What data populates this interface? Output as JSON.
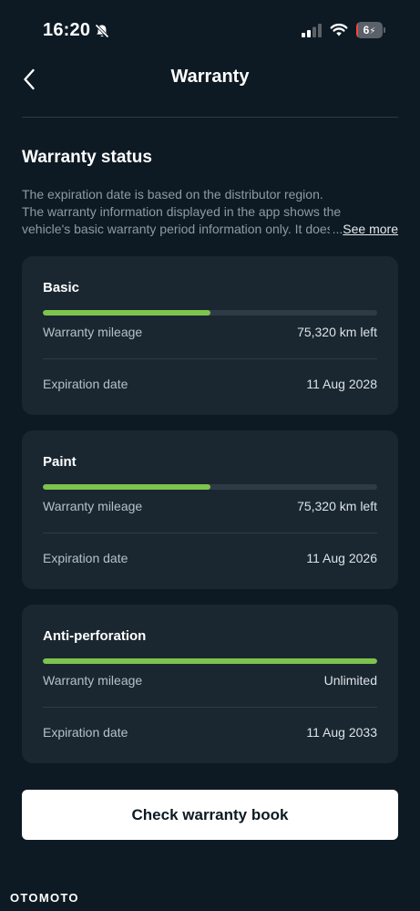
{
  "status_bar": {
    "time": "16:20",
    "battery_level": "6",
    "battery_fraction": 0.06,
    "battery_color": "#ff453a",
    "icons": [
      "bell-off-icon",
      "signal-icon",
      "wifi-icon",
      "battery-icon"
    ]
  },
  "header": {
    "title": "Warranty",
    "back_icon": "chevron-left-icon"
  },
  "section": {
    "title": "Warranty status",
    "description_lines": [
      "The expiration date is based on the distributor region.",
      "The warranty information displayed in the app shows the",
      "vehicle's basic warranty period information only. It does"
    ],
    "see_more": "See more",
    "ellipsis": "..."
  },
  "cards": [
    {
      "title": "Basic",
      "progress": 0.5,
      "mileage_label": "Warranty mileage",
      "mileage_value": "75,320 km left",
      "expiry_label": "Expiration date",
      "expiry_value": "11 Aug 2028"
    },
    {
      "title": "Paint",
      "progress": 0.5,
      "mileage_label": "Warranty mileage",
      "mileage_value": "75,320 km left",
      "expiry_label": "Expiration date",
      "expiry_value": "11 Aug 2026"
    },
    {
      "title": "Anti-perforation",
      "progress": 1.0,
      "mileage_label": "Warranty mileage",
      "mileage_value": "Unlimited",
      "expiry_label": "Expiration date",
      "expiry_value": "11 Aug 2033"
    }
  ],
  "actions": {
    "check_button": "Check warranty book"
  },
  "watermark": "OTOMOTO",
  "colors": {
    "background": "#0d1a23",
    "card": "#1a2731",
    "progress_fill": "#7ec34d",
    "progress_track": "#2e3b45",
    "button": "#ffffff"
  }
}
